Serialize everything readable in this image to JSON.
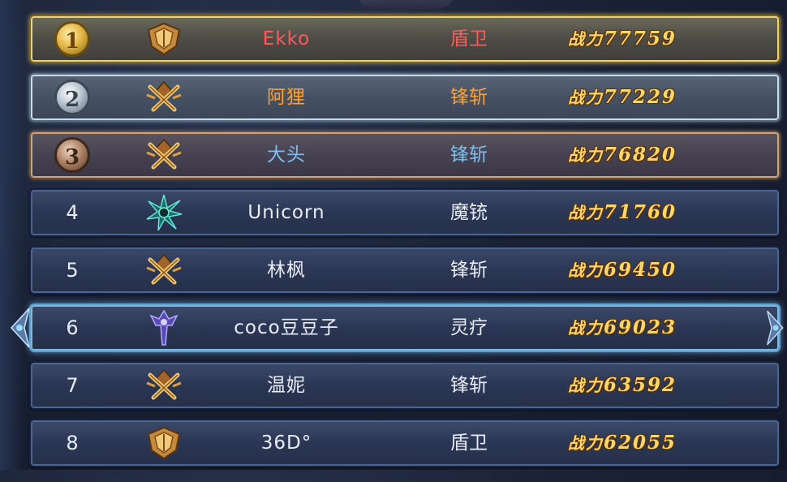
{
  "rows": [
    {
      "rank": "1",
      "medal": "gold",
      "class_icon": "shield-icon",
      "name": "Ekko",
      "job": "盾卫",
      "power_prefix": "战力",
      "power": "77759"
    },
    {
      "rank": "2",
      "medal": "silver",
      "class_icon": "crossed-swords-icon",
      "name": "阿狸",
      "job": "锋斩",
      "power_prefix": "战力",
      "power": "77229"
    },
    {
      "rank": "3",
      "medal": "bronze",
      "class_icon": "crossed-swords-icon",
      "name": "大头",
      "job": "锋斩",
      "power_prefix": "战力",
      "power": "76820"
    },
    {
      "rank": "4",
      "medal": "",
      "class_icon": "star-burst-icon",
      "name": "Unicorn",
      "job": "魔铳",
      "power_prefix": "战力",
      "power": "71760"
    },
    {
      "rank": "5",
      "medal": "",
      "class_icon": "crossed-swords-icon",
      "name": "林枫",
      "job": "锋斩",
      "power_prefix": "战力",
      "power": "69450"
    },
    {
      "rank": "6",
      "medal": "",
      "class_icon": "staff-icon",
      "name": "coco豆豆子",
      "job": "灵疗",
      "power_prefix": "战力",
      "power": "69023"
    },
    {
      "rank": "7",
      "medal": "",
      "class_icon": "crossed-swords-icon",
      "name": "温妮",
      "job": "锋斩",
      "power_prefix": "战力",
      "power": "63592"
    },
    {
      "rank": "8",
      "medal": "",
      "class_icon": "shield-icon",
      "name": "36D°",
      "job": "盾卫",
      "power_prefix": "战力",
      "power": "62055"
    }
  ],
  "selected_rank": "6",
  "colors": {
    "gold_text": "#ff5a5a",
    "silver_text": "#ffa030",
    "bronze_text": "#7cc0f0",
    "power": "#ffd66a",
    "selected_border": "#7ab8e0"
  }
}
